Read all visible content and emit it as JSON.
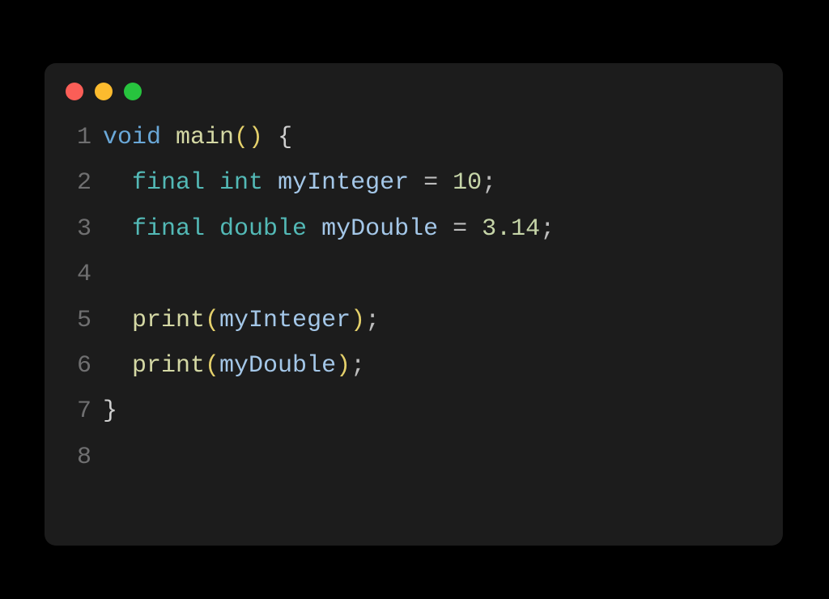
{
  "window": {
    "traffic_lights": [
      "red",
      "yellow",
      "green"
    ]
  },
  "code": {
    "lines": [
      {
        "num": "1",
        "tokens": [
          {
            "cls": "tok-keyword-type",
            "t": "void"
          },
          {
            "cls": "tok-plain",
            "t": " "
          },
          {
            "cls": "tok-func-name",
            "t": "main"
          },
          {
            "cls": "tok-paren",
            "t": "()"
          },
          {
            "cls": "tok-plain",
            "t": " "
          },
          {
            "cls": "tok-brace",
            "t": "{"
          }
        ]
      },
      {
        "num": "2",
        "tokens": [
          {
            "cls": "tok-plain",
            "t": "  "
          },
          {
            "cls": "tok-keyword-mod",
            "t": "final"
          },
          {
            "cls": "tok-plain",
            "t": " "
          },
          {
            "cls": "tok-keyword-mod",
            "t": "int"
          },
          {
            "cls": "tok-plain",
            "t": " "
          },
          {
            "cls": "tok-ident",
            "t": "myInteger"
          },
          {
            "cls": "tok-plain",
            "t": " "
          },
          {
            "cls": "tok-punct",
            "t": "="
          },
          {
            "cls": "tok-plain",
            "t": " "
          },
          {
            "cls": "tok-number",
            "t": "10"
          },
          {
            "cls": "tok-punct",
            "t": ";"
          }
        ]
      },
      {
        "num": "3",
        "tokens": [
          {
            "cls": "tok-plain",
            "t": "  "
          },
          {
            "cls": "tok-keyword-mod",
            "t": "final"
          },
          {
            "cls": "tok-plain",
            "t": " "
          },
          {
            "cls": "tok-keyword-mod",
            "t": "double"
          },
          {
            "cls": "tok-plain",
            "t": " "
          },
          {
            "cls": "tok-ident",
            "t": "myDouble"
          },
          {
            "cls": "tok-plain",
            "t": " "
          },
          {
            "cls": "tok-punct",
            "t": "="
          },
          {
            "cls": "tok-plain",
            "t": " "
          },
          {
            "cls": "tok-number",
            "t": "3.14"
          },
          {
            "cls": "tok-punct",
            "t": ";"
          }
        ]
      },
      {
        "num": "4",
        "tokens": []
      },
      {
        "num": "5",
        "tokens": [
          {
            "cls": "tok-plain",
            "t": "  "
          },
          {
            "cls": "tok-func-name",
            "t": "print"
          },
          {
            "cls": "tok-paren",
            "t": "("
          },
          {
            "cls": "tok-ident",
            "t": "myInteger"
          },
          {
            "cls": "tok-paren",
            "t": ")"
          },
          {
            "cls": "tok-punct",
            "t": ";"
          }
        ]
      },
      {
        "num": "6",
        "tokens": [
          {
            "cls": "tok-plain",
            "t": "  "
          },
          {
            "cls": "tok-func-name",
            "t": "print"
          },
          {
            "cls": "tok-paren",
            "t": "("
          },
          {
            "cls": "tok-ident",
            "t": "myDouble"
          },
          {
            "cls": "tok-paren",
            "t": ")"
          },
          {
            "cls": "tok-punct",
            "t": ";"
          }
        ]
      },
      {
        "num": "7",
        "tokens": [
          {
            "cls": "tok-brace",
            "t": "}"
          }
        ]
      },
      {
        "num": "8",
        "tokens": []
      }
    ]
  }
}
